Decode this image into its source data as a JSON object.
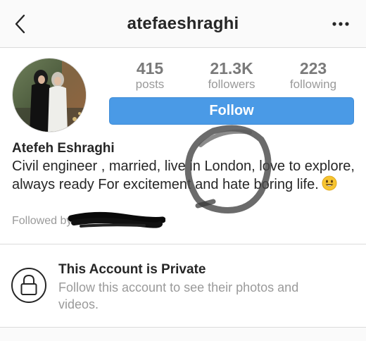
{
  "header": {
    "username": "atefaeshraghi",
    "back_icon": "chevron-left-icon",
    "more_icon": "more-horizontal-icon"
  },
  "stats": {
    "posts_count": "415",
    "posts_label": "posts",
    "followers_count": "21.3K",
    "followers_label": "followers",
    "following_count": "223",
    "following_label": "following"
  },
  "actions": {
    "follow_label": "Follow"
  },
  "profile": {
    "display_name": "Atefeh Eshraghi",
    "bio": "Civil engineer , married, live in London, love to explore, always ready For excitement and hate boring life.",
    "bio_emoji": "smiling-face-emoji",
    "followed_by_label": "Followed by"
  },
  "private_notice": {
    "title": "This Account is Private",
    "description": "Follow this account to see their photos and videos.",
    "icon": "lock-icon"
  },
  "colors": {
    "follow_button": "#4a9ae6",
    "text_primary": "#262626",
    "text_secondary": "#9a9a9a",
    "divider": "#dbdbdb"
  }
}
